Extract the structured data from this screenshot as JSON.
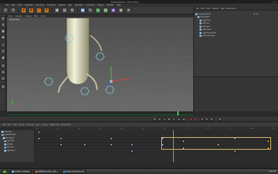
{
  "window": {
    "title": "Rolling Beans - Pencil Test",
    "sys_text": "_ □ ✕"
  },
  "menubar": [
    "File",
    "Edit",
    "Tools",
    "Selection",
    "Structure",
    "Functions",
    "Objects",
    "Tags",
    "MoGraph",
    "Character",
    "Plugins",
    "Window",
    "Help"
  ],
  "toolbar": {
    "icons": [
      "undo-icon",
      "redo-icon",
      "live-select-icon",
      "move-icon",
      "scale-icon",
      "rotate-icon",
      "render-icon",
      "cube-icon",
      "pen-icon",
      "subdivision-icon",
      "array-icon",
      "deformer-icon",
      "camera-icon",
      "light-icon"
    ]
  },
  "viewport": {
    "menu": [
      "View",
      "Cameras",
      "Display",
      "Filter",
      "Panel"
    ],
    "label": "Perspective"
  },
  "objects_panel": {
    "menu": [
      "File",
      "Edit",
      "View",
      "Objects",
      "Tags",
      "Bookmarks"
    ],
    "items": [
      "Hyperball R.02",
      "Null Object",
      "right foot",
      "left foot",
      "left hand",
      "right hand",
      "right Front Knee",
      "left Front Knee"
    ]
  },
  "timeline": {
    "menu": [
      "File",
      "Edit",
      "View",
      "Frame",
      "Functions",
      "Key",
      "F-Curve",
      "Motion Clip",
      "Bookmarks"
    ],
    "ruler": [
      "0",
      "10",
      "20",
      "30",
      "40",
      "50",
      "60",
      "70",
      "80",
      "90",
      "100",
      "110"
    ],
    "tracks": [
      "Summary",
      "Hyperball R.02",
      "Null Object",
      "right foot",
      "left foot",
      "left hand",
      "right hand"
    ]
  },
  "taskbar": {
    "tasks": [
      "untitled - Notepad",
      "CINEMA 4D R10 - Roll...",
      "Adobe Photoshop CS3"
    ],
    "clock": "1:04 PM"
  }
}
